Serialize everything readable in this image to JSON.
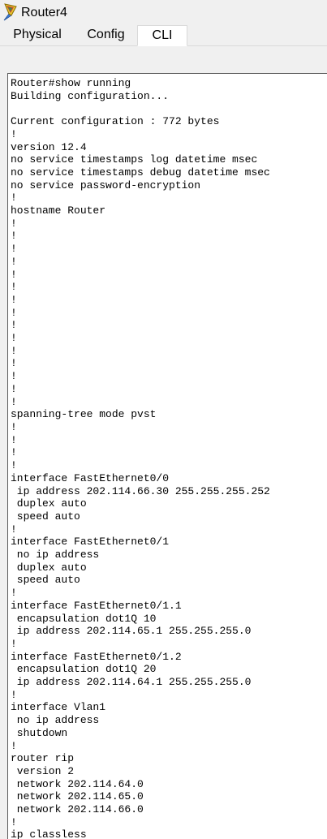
{
  "window": {
    "title": "Router4"
  },
  "tabs": [
    {
      "label": "Physical",
      "active": false
    },
    {
      "label": "Config",
      "active": false
    },
    {
      "label": "CLI",
      "active": true
    }
  ],
  "terminal": {
    "lines": [
      "Router#show running",
      "Building configuration...",
      "",
      "Current configuration : 772 bytes",
      "!",
      "version 12.4",
      "no service timestamps log datetime msec",
      "no service timestamps debug datetime msec",
      "no service password-encryption",
      "!",
      "hostname Router",
      "!",
      "!",
      "!",
      "!",
      "!",
      "!",
      "!",
      "!",
      "!",
      "!",
      "!",
      "!",
      "!",
      "!",
      "!",
      "spanning-tree mode pvst",
      "!",
      "!",
      "!",
      "!",
      "interface FastEthernet0/0",
      " ip address 202.114.66.30 255.255.255.252",
      " duplex auto",
      " speed auto",
      "!",
      "interface FastEthernet0/1",
      " no ip address",
      " duplex auto",
      " speed auto",
      "!",
      "interface FastEthernet0/1.1",
      " encapsulation dot1Q 10",
      " ip address 202.114.65.1 255.255.255.0",
      "!",
      "interface FastEthernet0/1.2",
      " encapsulation dot1Q 20",
      " ip address 202.114.64.1 255.255.255.0",
      "!",
      "interface Vlan1",
      " no ip address",
      " shutdown",
      "!",
      "router rip",
      " version 2",
      " network 202.114.64.0",
      " network 202.114.65.0",
      " network 202.114.66.0",
      "!",
      "ip classless",
      "!"
    ]
  },
  "colors": {
    "chrome_background": "#f0f0f0",
    "terminal_background": "#ffffff",
    "terminal_text": "#000000",
    "terminal_border": "#5a5a5a"
  },
  "icons": {
    "app": "router-icon"
  }
}
